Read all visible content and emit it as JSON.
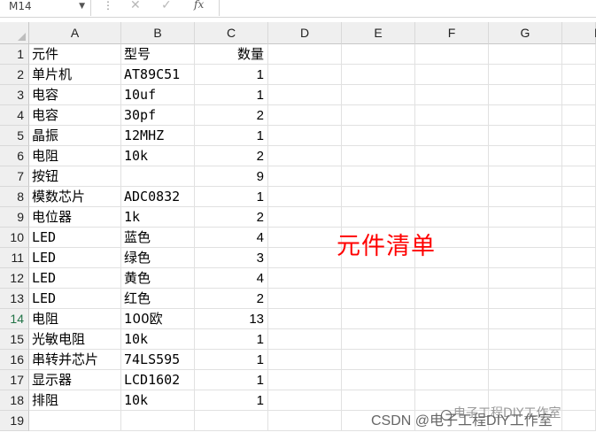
{
  "namebox": {
    "value": "M14"
  },
  "formula": {
    "fx": "fx",
    "cancel": "✕",
    "confirm": "✓"
  },
  "columns": [
    "A",
    "B",
    "C",
    "D",
    "E",
    "F",
    "G",
    "H"
  ],
  "rows": [
    {
      "n": "1",
      "a": "元件",
      "b": "型号",
      "c": "数量"
    },
    {
      "n": "2",
      "a": "单片机",
      "b": "AT89C51",
      "c": "1"
    },
    {
      "n": "3",
      "a": "电容",
      "b": "10uf",
      "c": "1"
    },
    {
      "n": "4",
      "a": "电容",
      "b": "30pf",
      "c": "2"
    },
    {
      "n": "5",
      "a": "晶振",
      "b": "12MHZ",
      "c": "1"
    },
    {
      "n": "6",
      "a": "电阻",
      "b": "10k",
      "c": "2"
    },
    {
      "n": "7",
      "a": "按钮",
      "b": "",
      "c": "9"
    },
    {
      "n": "8",
      "a": "模数芯片",
      "b": "ADC0832",
      "c": "1"
    },
    {
      "n": "9",
      "a": "电位器",
      "b": "1k",
      "c": "2"
    },
    {
      "n": "10",
      "a": "LED",
      "b": "蓝色",
      "c": "4"
    },
    {
      "n": "11",
      "a": "LED",
      "b": "绿色",
      "c": "3"
    },
    {
      "n": "12",
      "a": "LED",
      "b": "黄色",
      "c": "4"
    },
    {
      "n": "13",
      "a": "LED",
      "b": "红色",
      "c": "2"
    },
    {
      "n": "14",
      "a": "电阻",
      "b": "100欧",
      "c": "13"
    },
    {
      "n": "15",
      "a": "光敏电阻",
      "b": "10k",
      "c": "1"
    },
    {
      "n": "16",
      "a": "串转并芯片",
      "b": "74LS595",
      "c": "1"
    },
    {
      "n": "17",
      "a": "显示器",
      "b": "LCD1602",
      "c": "1"
    },
    {
      "n": "18",
      "a": "排阻",
      "b": "10k",
      "c": "1"
    },
    {
      "n": "19",
      "a": "",
      "b": "",
      "c": ""
    }
  ],
  "overlay_title": "元件清单",
  "watermark": {
    "csdn": "CSDN @电子工程DIY工作室",
    "ghost": "电子工程DIY工作室"
  },
  "colors": {
    "overlay": "#ff0000",
    "selected_row": "#217346"
  }
}
